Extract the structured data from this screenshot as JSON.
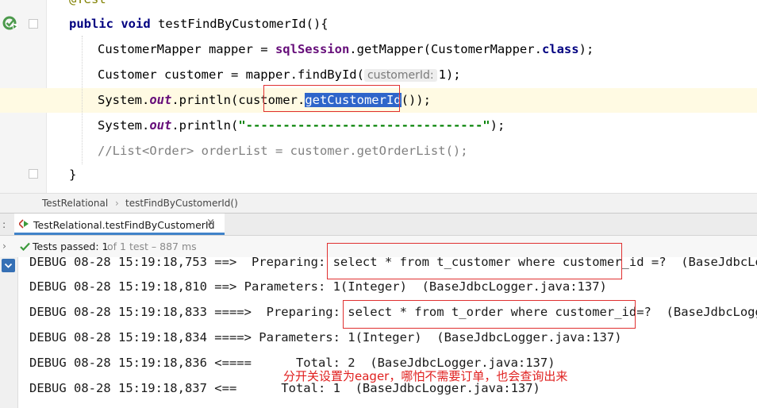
{
  "editor": {
    "truncated_top": "@Test",
    "method_signature": {
      "keyword": "public void",
      "name": " testFindByCustomerId(){"
    },
    "line1": {
      "pre": "CustomerMapper mapper = ",
      "session": "sqlSession",
      "mid": ".getMapper(CustomerMapper.",
      "kw": "class",
      "post": ");"
    },
    "line2": {
      "pre": "Customer customer = mapper.findById(",
      "hint": "customerId:",
      "post": "1);"
    },
    "line3": {
      "pre": "System.",
      "field": "out",
      "mid": ".println(customer.",
      "selected": "getCustomerId",
      "post": "());"
    },
    "line4": {
      "pre": "System.",
      "field": "out",
      "mid": ".println(",
      "string": "\"--------------------------------\"",
      "post": ");"
    },
    "line5": "//List<Order> orderList = customer.getOrderList();",
    "closing_brace": "}"
  },
  "breadcrumb": {
    "class_name": "TestRelational",
    "separator": "›",
    "method_name": "testFindByCustomerId()"
  },
  "run_panel": {
    "left_label": ":",
    "tab_label": "TestRelational.testFindByCustomerId",
    "tab_close": "×",
    "status_main": "Tests passed: 1",
    "status_detail": "of 1 test – 887 ms"
  },
  "console": {
    "lines": [
      "DEBUG 08-28 15:19:18,753 ==>  Preparing: select * from t_customer where customer_id =?  (BaseJdbcLogger",
      "DEBUG 08-28 15:19:18,810 ==> Parameters: 1(Integer)  (BaseJdbcLogger.java:137)",
      "DEBUG 08-28 15:19:18,833 ====>  Preparing: select * from t_order where customer_id=?  (BaseJdbcLogger.",
      "DEBUG 08-28 15:19:18,834 ====> Parameters: 1(Integer)  (BaseJdbcLogger.java:137)",
      "DEBUG 08-28 15:19:18,836 <====      Total: 2  (BaseJdbcLogger.java:137)",
      "DEBUG 08-28 15:19:18,837 <==      Total: 1  (BaseJdbcLogger.java:137)"
    ],
    "annotation": "分开关设置为eager，哪怕不需要订单，也会查询出来"
  },
  "colors": {
    "keyword": "#000080",
    "field": "#660e7a",
    "string": "#008000",
    "selection": "#2f65ca",
    "highlight_box": "#e03030",
    "pass_green": "#3c9a3c"
  }
}
